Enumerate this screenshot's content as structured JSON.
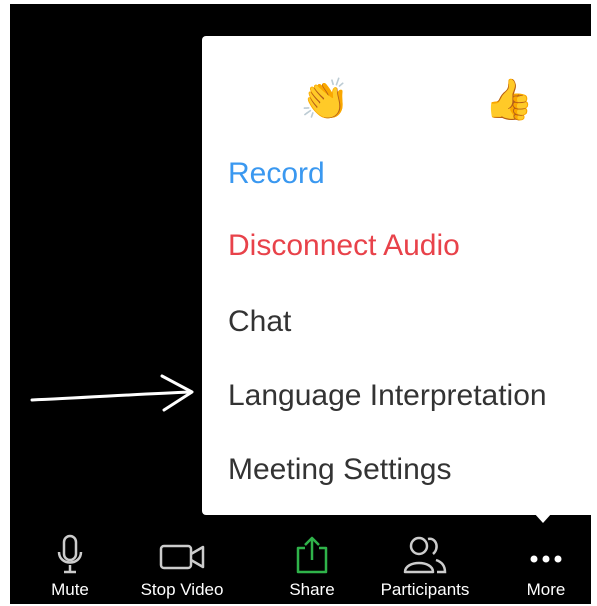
{
  "reactions": [
    {
      "icon": "clapping-hands-icon",
      "glyph": "👏"
    },
    {
      "icon": "thumbs-up-icon",
      "glyph": "👍"
    }
  ],
  "menu": {
    "record": "Record",
    "disconnect_audio": "Disconnect Audio",
    "chat": "Chat",
    "language_interpretation": "Language Interpretation",
    "meeting_settings": "Meeting Settings"
  },
  "toolbar": {
    "mute": "Mute",
    "stop_video": "Stop Video",
    "share": "Share",
    "participants": "Participants",
    "more": "More"
  },
  "colors": {
    "record": "#3a98f0",
    "disconnect": "#e8424a",
    "share_icon": "#2fb34a",
    "background": "#000000"
  }
}
